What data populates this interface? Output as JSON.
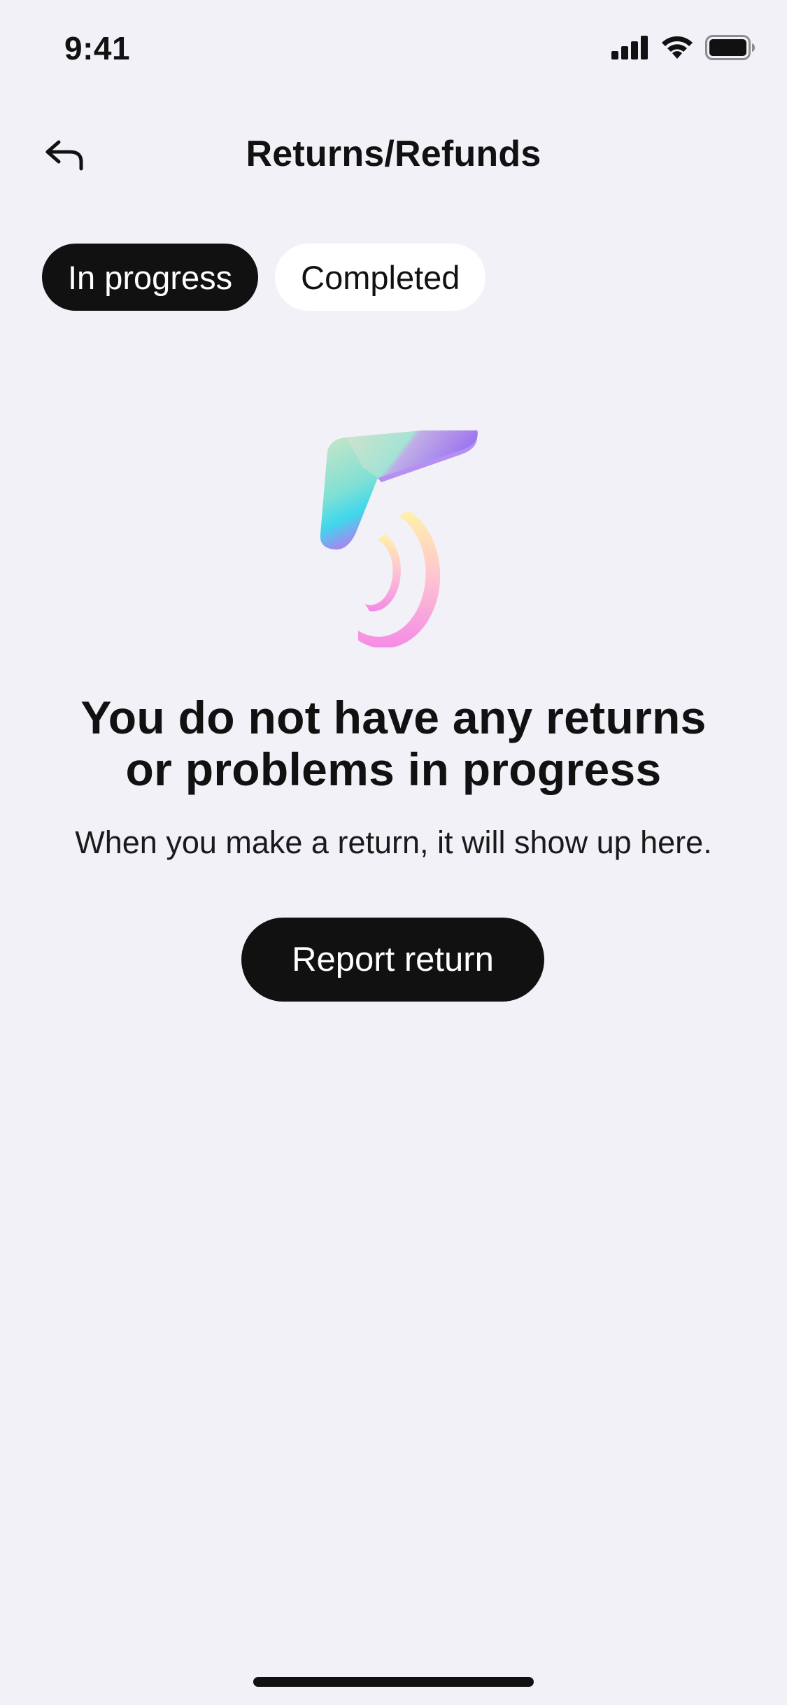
{
  "status_bar": {
    "time": "9:41",
    "icons": [
      "cellular-signal-icon",
      "wifi-icon",
      "battery-icon"
    ]
  },
  "nav": {
    "back_icon": "back-arrow-icon",
    "title": "Returns/Refunds"
  },
  "tabs": [
    {
      "label": "In progress",
      "active": true
    },
    {
      "label": "Completed",
      "active": false
    }
  ],
  "empty_state": {
    "illustration": "boomerang-illustration",
    "title_line1": "You do not have any returns",
    "title_line2": "or problems in progress",
    "subtitle": "When you make a return, it will show up here."
  },
  "actions": {
    "report_return_label": "Report return"
  },
  "colors": {
    "background": "#f2f1f7",
    "primary": "#111111",
    "on_primary": "#ffffff",
    "accent_gradient": [
      "#d8e6c8",
      "#3fd9e8",
      "#a35af5",
      "#f7a2e0",
      "#fff0a8"
    ]
  }
}
